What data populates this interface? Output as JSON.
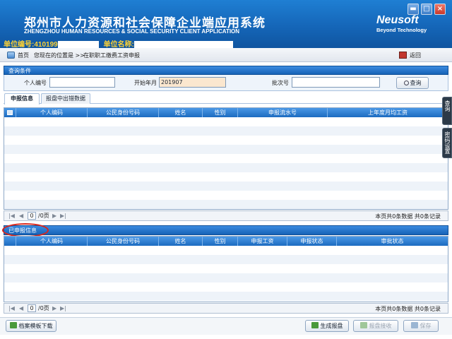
{
  "header": {
    "title_cn": "郑州市人力资源和社会保障企业端应用系统",
    "title_en": "ZHENGZHOU HUMAN RESOURCES & SOCIAL SECURITY CLIENT APPLICATION",
    "unit_code_label": "单位编号:410199",
    "unit_name_label": "单位名称:",
    "brand": "Neusoft",
    "brand_sub": "Beyond Technology",
    "window_buttons": {
      "minimize": "▬",
      "maximize": "□",
      "close": "×"
    }
  },
  "nav": {
    "home": "首页",
    "location_label": "您现在的位置是 >>",
    "location": "在职职工缴费工资申报",
    "back": "返回"
  },
  "query": {
    "section_title": "查询条件",
    "person_id_label": "个人编号",
    "person_id_value": "",
    "start_month_label": "开始年月",
    "start_month_value": "201907",
    "batch_label": "批次号",
    "batch_value": "",
    "search_button": "查询"
  },
  "tabs": [
    {
      "label": "申报信息",
      "active": true
    },
    {
      "label": "报盘中出错数据",
      "active": false
    }
  ],
  "declare_grid": {
    "columns": [
      "",
      "个人编码",
      "公民身份号码",
      "姓名",
      "性别",
      "申报流水号",
      "上年度月均工资"
    ],
    "rows": []
  },
  "pager1": {
    "page_value": "0",
    "pages_label": "/0页",
    "info": "本页共0条数据 共0条记录"
  },
  "submitted": {
    "section_title": "已申报信息",
    "columns": [
      "",
      "个人编码",
      "公民身份号码",
      "姓名",
      "性别",
      "申报工资",
      "申报状态",
      "审批状态"
    ],
    "rows": []
  },
  "pager2": {
    "page_value": "0",
    "pages_label": "/0页",
    "info": "本页共0条数据 共0条记录"
  },
  "side_tabs": [
    "查询",
    "密码设置"
  ],
  "footer": {
    "template_download": "档案模板下载",
    "generate_disk": "生成报盘",
    "disk_receive": "报盘接收",
    "save": "保存"
  },
  "colors": {
    "header_blue": "#1566b8",
    "grid_header": "#1c6bc0",
    "unit_text": "#ffd233",
    "highlight_ellipse": "#d9261c"
  }
}
